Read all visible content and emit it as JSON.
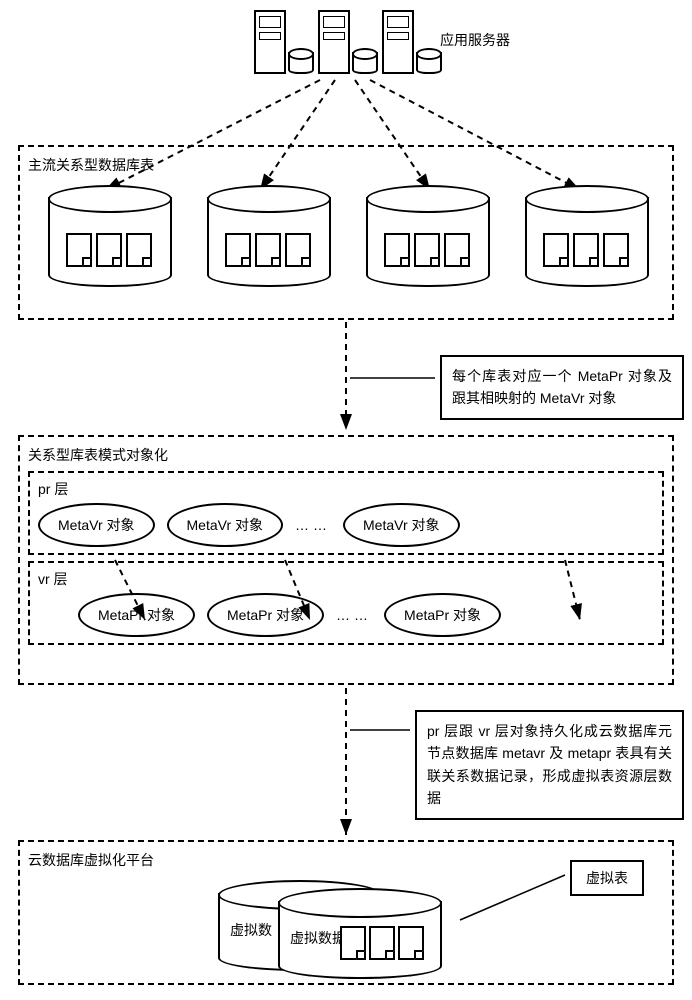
{
  "top": {
    "server_label": "应用服务器"
  },
  "tier1": {
    "title": "主流关系型数据库表"
  },
  "anno1": {
    "text": "每个库表对应一个 MetaPr 对象及跟其相映射的 MetaVr 对象"
  },
  "tier2": {
    "title": "关系型库表模式对象化",
    "pr_label": "pr 层",
    "vr_label": "vr 层",
    "metavr": "MetaVr 对象",
    "metapr": "MetaPr 对象",
    "dots": "……"
  },
  "anno2": {
    "text": "pr 层跟 vr 层对象持久化成云数据库元节点数据库 metavr 及 metapr 表具有关联关系数据记录，形成虚拟表资源层数据"
  },
  "tier3": {
    "title": "云数据库虚拟化平台",
    "back_label": "虚拟数",
    "front_label": "虚拟数据库"
  },
  "anno3": {
    "text": "虚拟表"
  }
}
